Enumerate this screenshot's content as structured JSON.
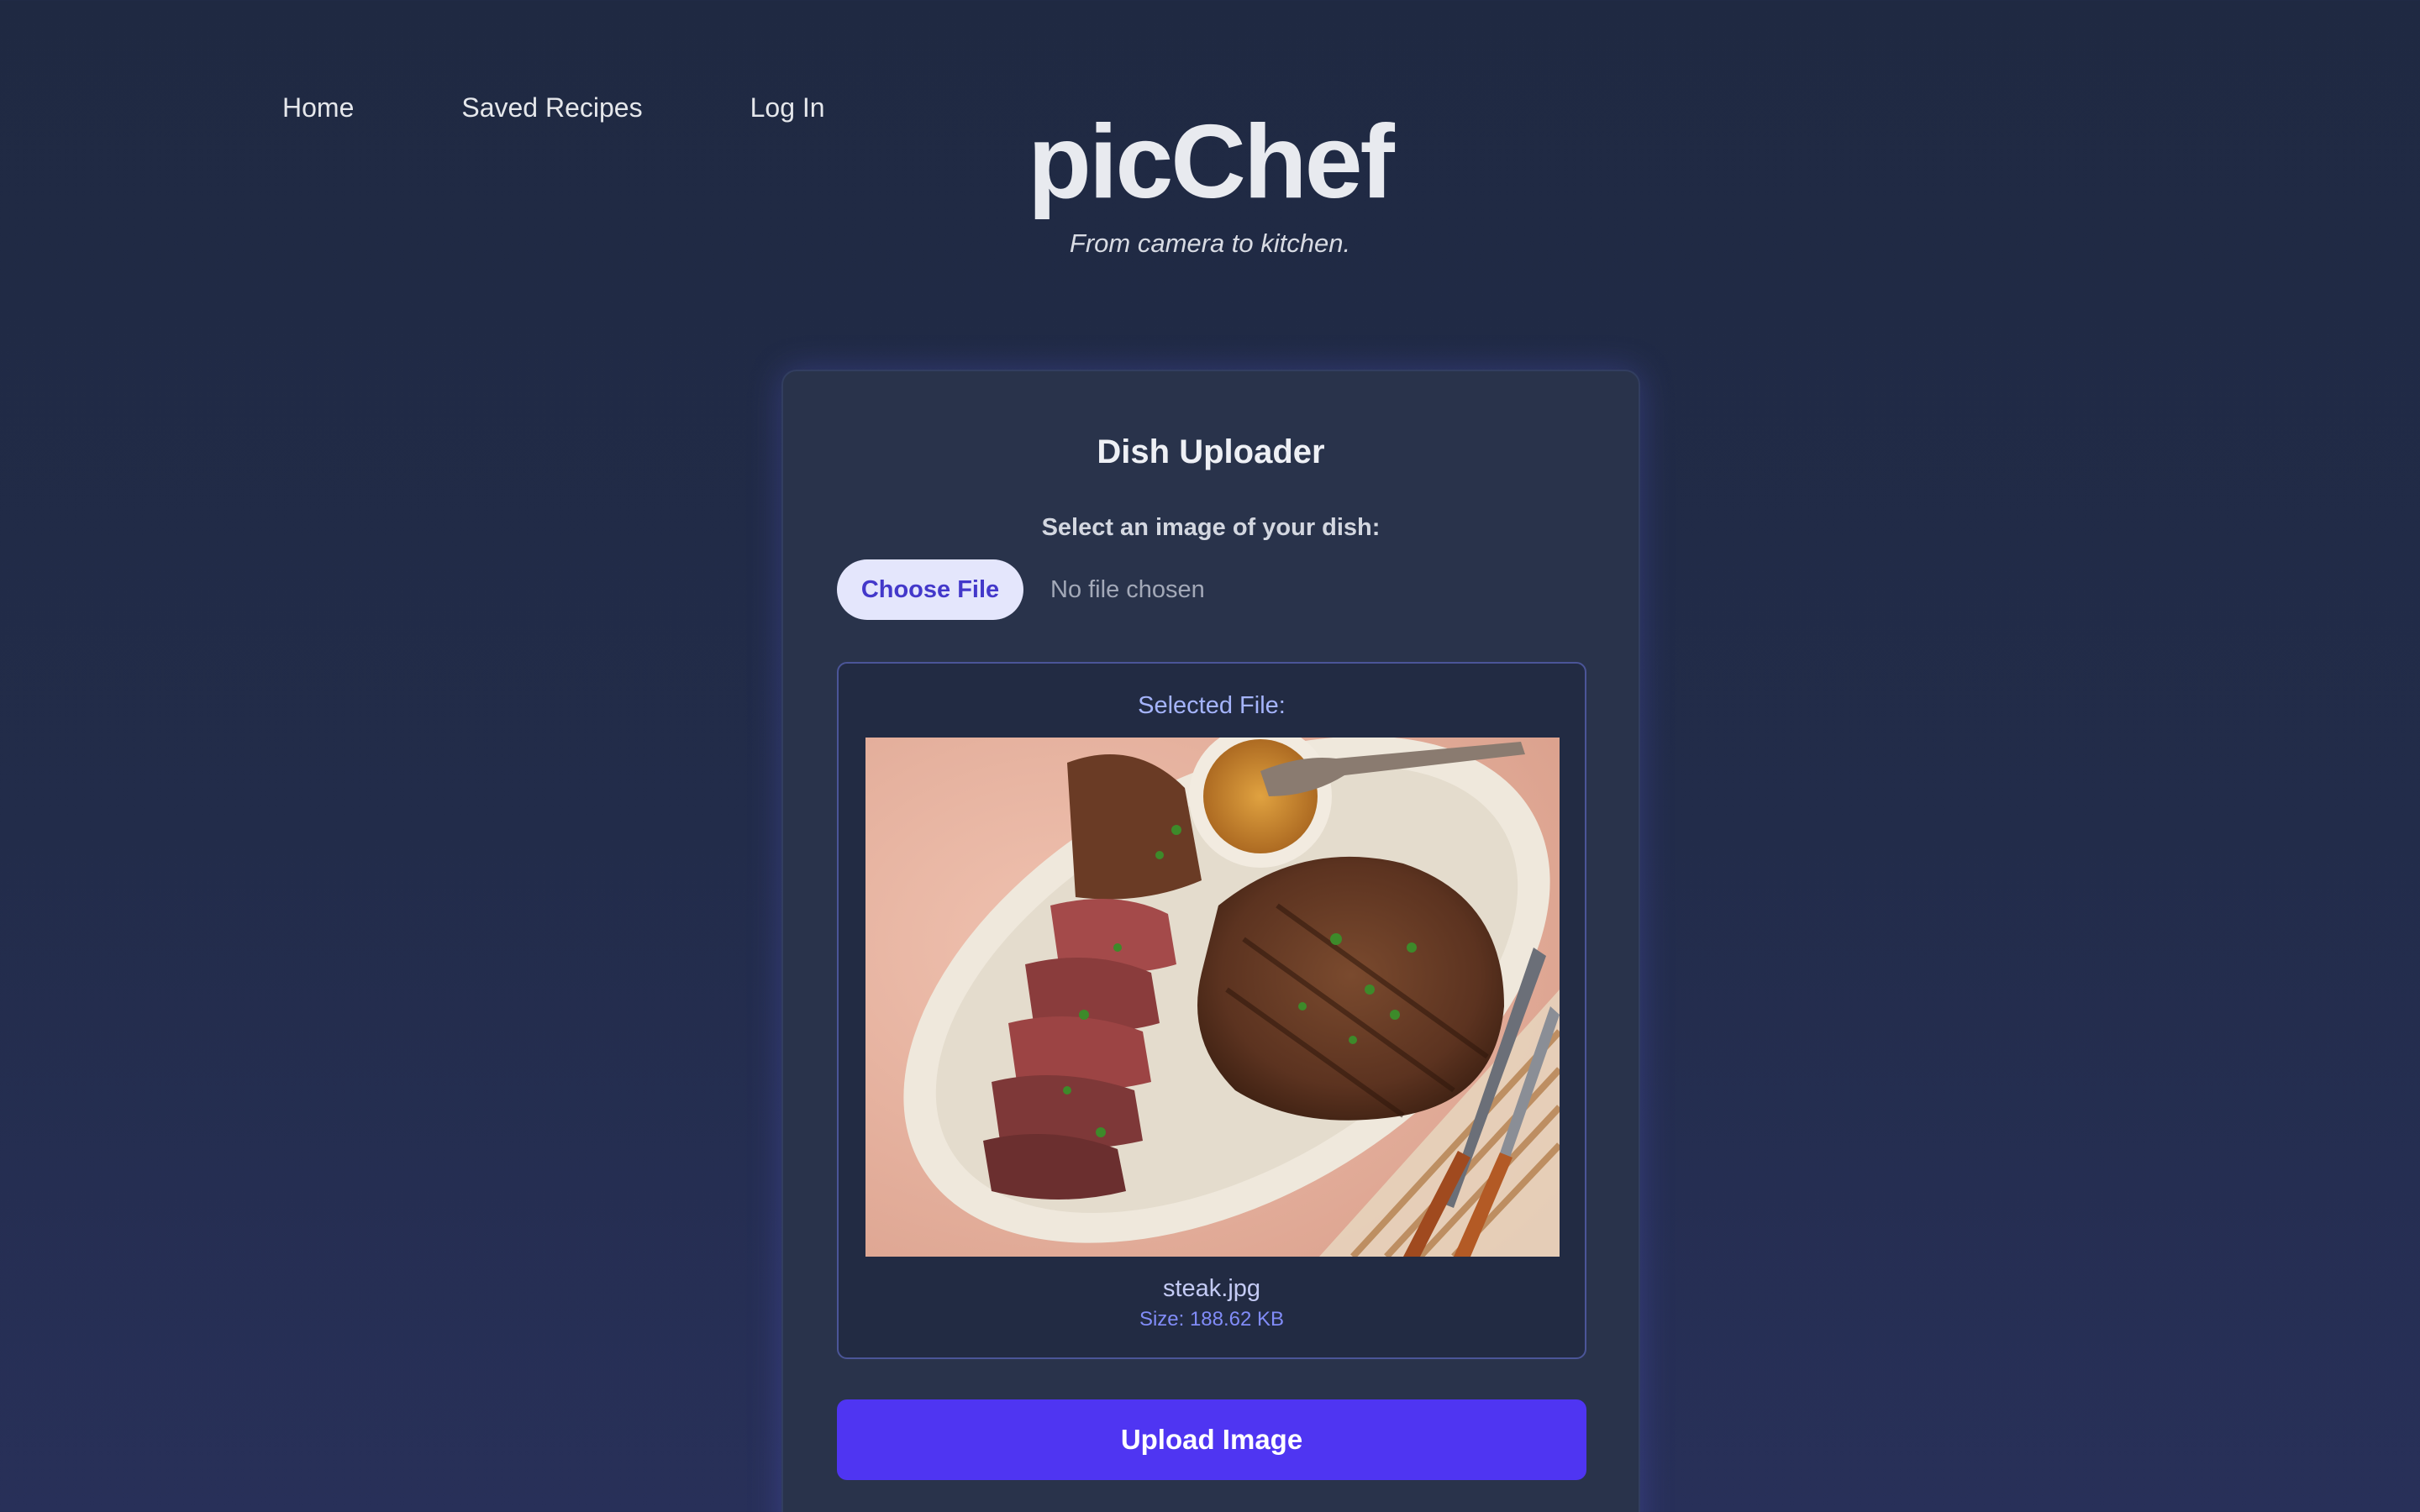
{
  "nav": {
    "items": [
      {
        "label": "Home"
      },
      {
        "label": "Saved Recipes"
      },
      {
        "label": "Log In"
      }
    ]
  },
  "header": {
    "brand": "picChef",
    "tagline": "From camera to kitchen."
  },
  "uploader": {
    "title": "Dish Uploader",
    "field_label": "Select an image of your dish:",
    "choose_button": "Choose File",
    "file_status": "No file chosen",
    "preview": {
      "label": "Selected File:",
      "file_name": "steak.jpg",
      "file_size": "Size: 188.62 KB"
    },
    "upload_button": "Upload Image"
  },
  "colors": {
    "background": "#1f2942",
    "card": "#29334b",
    "accent": "#4f35f2",
    "accent_text": "#a5b4fc"
  }
}
